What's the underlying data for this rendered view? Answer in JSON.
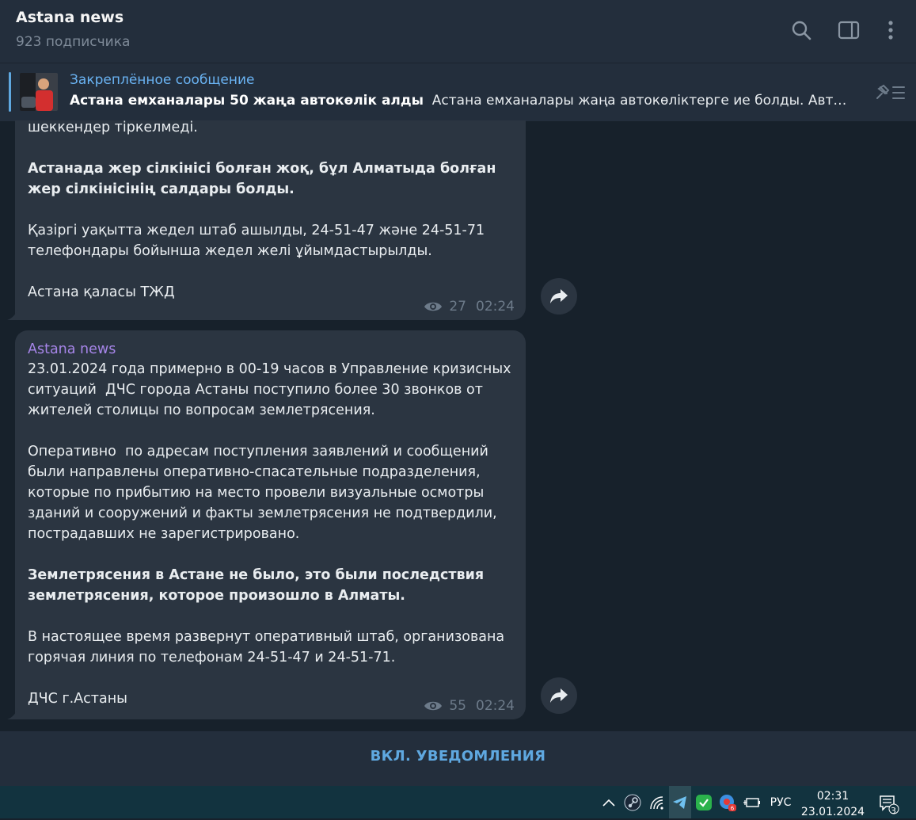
{
  "header": {
    "title": "Astana news",
    "subscribers": "923 подписчика"
  },
  "pinned": {
    "label": "Закреплённое сообщение",
    "headline": "Астана емханалары 50 жаңа автокөлік алды",
    "preview": "Астана емханалары жаңа автокөліктерге ие болды. Автокөліктер"
  },
  "messages": [
    {
      "sender": "",
      "partial_line": "шеккендер тіркелмеді.",
      "paragraphs": [
        {
          "text": "Астанада жер сілкінісі болған жоқ, бұл Алматыда болған жер сілкінісінің салдары болды.",
          "bold": true
        },
        {
          "text": "Қазіргі уақытта жедел штаб ашылды, 24-51-47 және 24-51-71 телефондары бойынша жедел желі ұйымдастырылды.",
          "bold": false
        },
        {
          "text": "Астана қаласы ТЖД",
          "bold": false
        }
      ],
      "views": "27",
      "time": "02:24"
    },
    {
      "sender": "Astana news",
      "paragraphs": [
        {
          "text": "23.01.2024 года примерно в 00-19 часов в Управление кризисных ситуаций  ДЧС города Астаны поступило более 30 звонков от жителей столицы по вопросам землетрясения.",
          "bold": false
        },
        {
          "text": "Оперативно  по адресам поступления заявлений и сообщений были направлены оперативно-спасательные подразделения, которые по прибытию на место провели визуальные осмотры зданий и сооружений и факты землетрясения не подтвердили, пострадавших не зарегистрировано.",
          "bold": false
        },
        {
          "text": "Землетрясения в Астане не было, это были последствия землетрясения, которое произошло в Алматы.",
          "bold": true
        },
        {
          "text": "В настоящее время развернут оперативный штаб, организована горячая линия по телефонам 24-51-47 и 24-51-71.",
          "bold": false
        },
        {
          "text": "ДЧС г.Астаны",
          "bold": false
        }
      ],
      "views": "55",
      "time": "02:24"
    }
  ],
  "bottom": {
    "notify_button": "ВКЛ. УВЕДОМЛЕНИЯ"
  },
  "taskbar": {
    "language": "РУС",
    "time": "02:31",
    "date": "23.01.2024",
    "notification_count": "3",
    "icons": [
      "chevron-up-icon",
      "steam-icon",
      "wifi-icon",
      "telegram-icon",
      "kaspersky-icon",
      "yandex-icon",
      "battery-icon",
      "notifications-icon"
    ]
  },
  "colors": {
    "background": "#17212b",
    "panel": "#232e3c",
    "bubble": "#2b3541",
    "accent": "#5fa8e0",
    "sender": "#a685e8"
  }
}
